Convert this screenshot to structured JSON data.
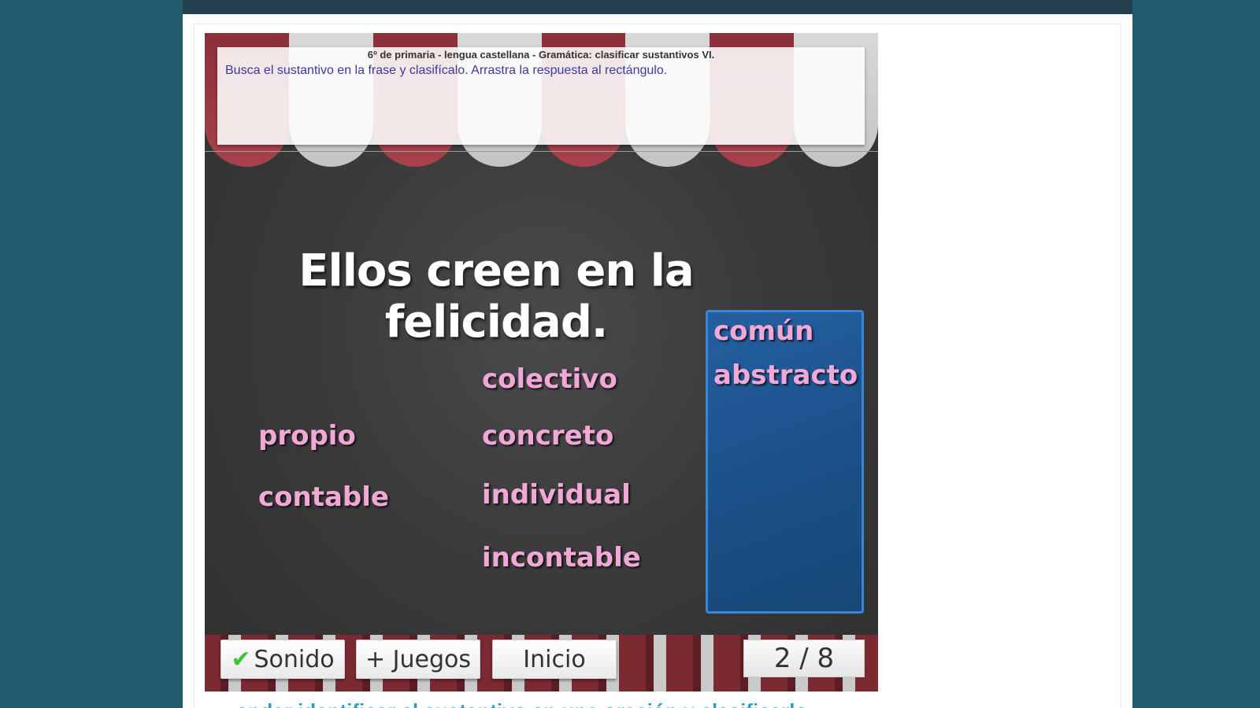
{
  "game": {
    "header": "6º de primaria - lengua castellana - Gramática: clasificar sustantivos VI.",
    "instruction": "Busca el sustantivo en la frase y clasifícalo. Arrastra la respuesta al rectángulo.",
    "sentence": "Ellos creen en la felicidad.",
    "options": {
      "colectivo": "colectivo",
      "propio": "propio",
      "concreto": "concreto",
      "contable": "contable",
      "individual": "individual",
      "incontable": "incontable"
    },
    "dropzone": {
      "answers": [
        "común",
        "abstracto"
      ]
    },
    "buttons": {
      "sound": "Sonido",
      "more_games": "+ Juegos",
      "home": "Inicio"
    },
    "progress": "2 / 8",
    "colors": {
      "word": "#f2a8d6",
      "dropzone": "#1a4f86",
      "instruction_text": "#3a3aa0",
      "check": "#3cc43c"
    }
  },
  "below": {
    "partial_heading": "ender identificar el sustantivo en una oración y clasificarlo"
  }
}
